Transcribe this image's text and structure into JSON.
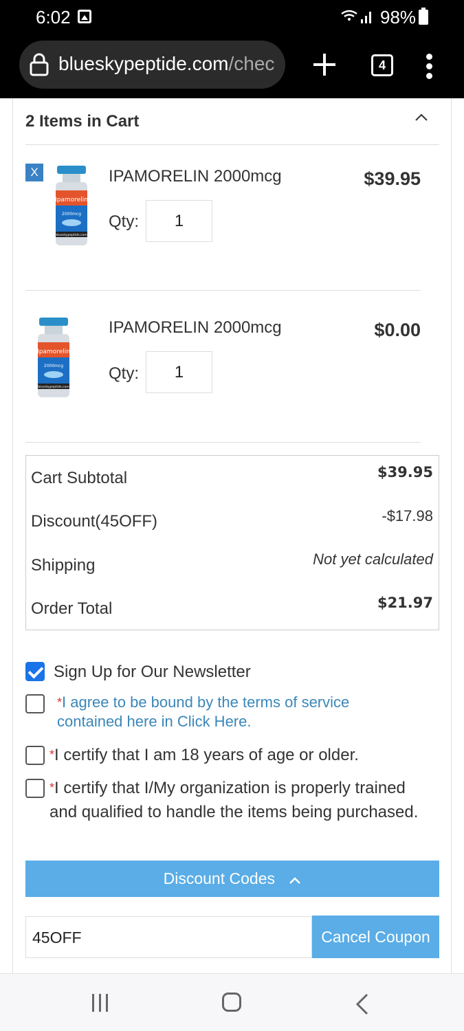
{
  "status_bar": {
    "time": "6:02",
    "battery": "98%"
  },
  "browser": {
    "url_main": "blueskypeptide.com",
    "url_rest": "/chec",
    "tab_count": "4"
  },
  "cart": {
    "title": "2 Items in Cart",
    "remove_label": "X",
    "items": [
      {
        "name": "IPAMORELIN 2000mcg",
        "qty_label": "Qty:",
        "qty": "1",
        "price": "$39.95"
      },
      {
        "name": "IPAMORELIN 2000mcg",
        "qty_label": "Qty:",
        "qty": "1",
        "price": "$0.00"
      }
    ],
    "vial_text": {
      "brand": "Ipamorelin",
      "dose": "2000mcg",
      "site": "blueskypeptide.com"
    }
  },
  "totals": {
    "subtotal_label": "Cart Subtotal",
    "subtotal": "$39.95",
    "discount_label": "Discount(45OFF)",
    "discount": "-$17.98",
    "shipping_label": "Shipping",
    "shipping": "Not yet calculated",
    "order_total_label": "Order Total",
    "order_total": "$21.97"
  },
  "checkboxes": {
    "newsletter": {
      "label": "Sign Up for Our Newsletter",
      "checked": true
    },
    "terms": {
      "label": "I agree to be bound by the terms of service contained here in Click Here.",
      "required_mark": "*"
    },
    "age": {
      "label": "I certify that I am 18 years of age or older.",
      "required_mark": "*"
    },
    "trained": {
      "label": "I certify that I/My organization is properly trained and qualified to handle the items being purchased.",
      "required_mark": "*"
    }
  },
  "discount": {
    "bar_label": "Discount Codes",
    "code_value": "45OFF",
    "cancel_label": "Cancel Coupon"
  },
  "colors": {
    "accent": "#5aade6",
    "checkbox": "#1a73e8",
    "remove": "#3a82c4",
    "link": "#3a87b8"
  }
}
